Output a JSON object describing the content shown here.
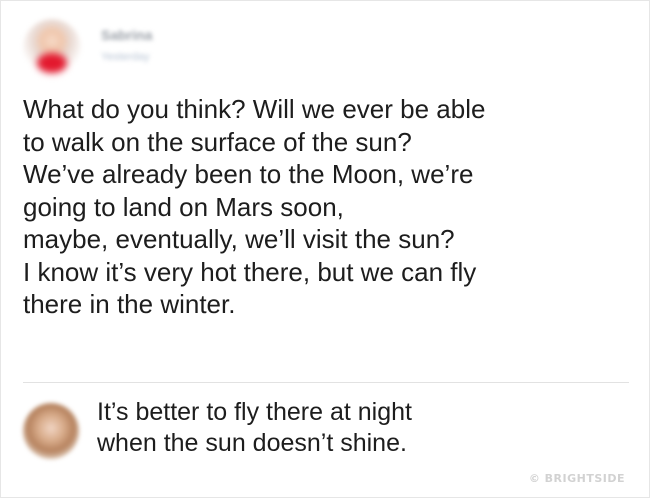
{
  "post": {
    "author_name": "Sabrina",
    "author_meta": "Yesterday",
    "text": "What do you think? Will we ever be able\nto walk on the surface of the sun?\nWe’ve already been to the Moon, we’re\ngoing to land on Mars soon,\nmaybe, eventually, we’ll visit the sun?\nI know it’s very hot there, but we can fly\nthere in the winter."
  },
  "comment": {
    "text": "It’s better to fly there at night\nwhen the sun doesn’t shine."
  },
  "watermark": {
    "text": "© BRIGHTSIDE"
  },
  "colors": {
    "background": "#ffffff",
    "text": "#1d1d1d",
    "divider": "#e2e2e2",
    "watermark": "#d2d2d2"
  },
  "icons": {
    "post_avatar": "avatar-photo",
    "comment_avatar": "avatar-photo"
  }
}
